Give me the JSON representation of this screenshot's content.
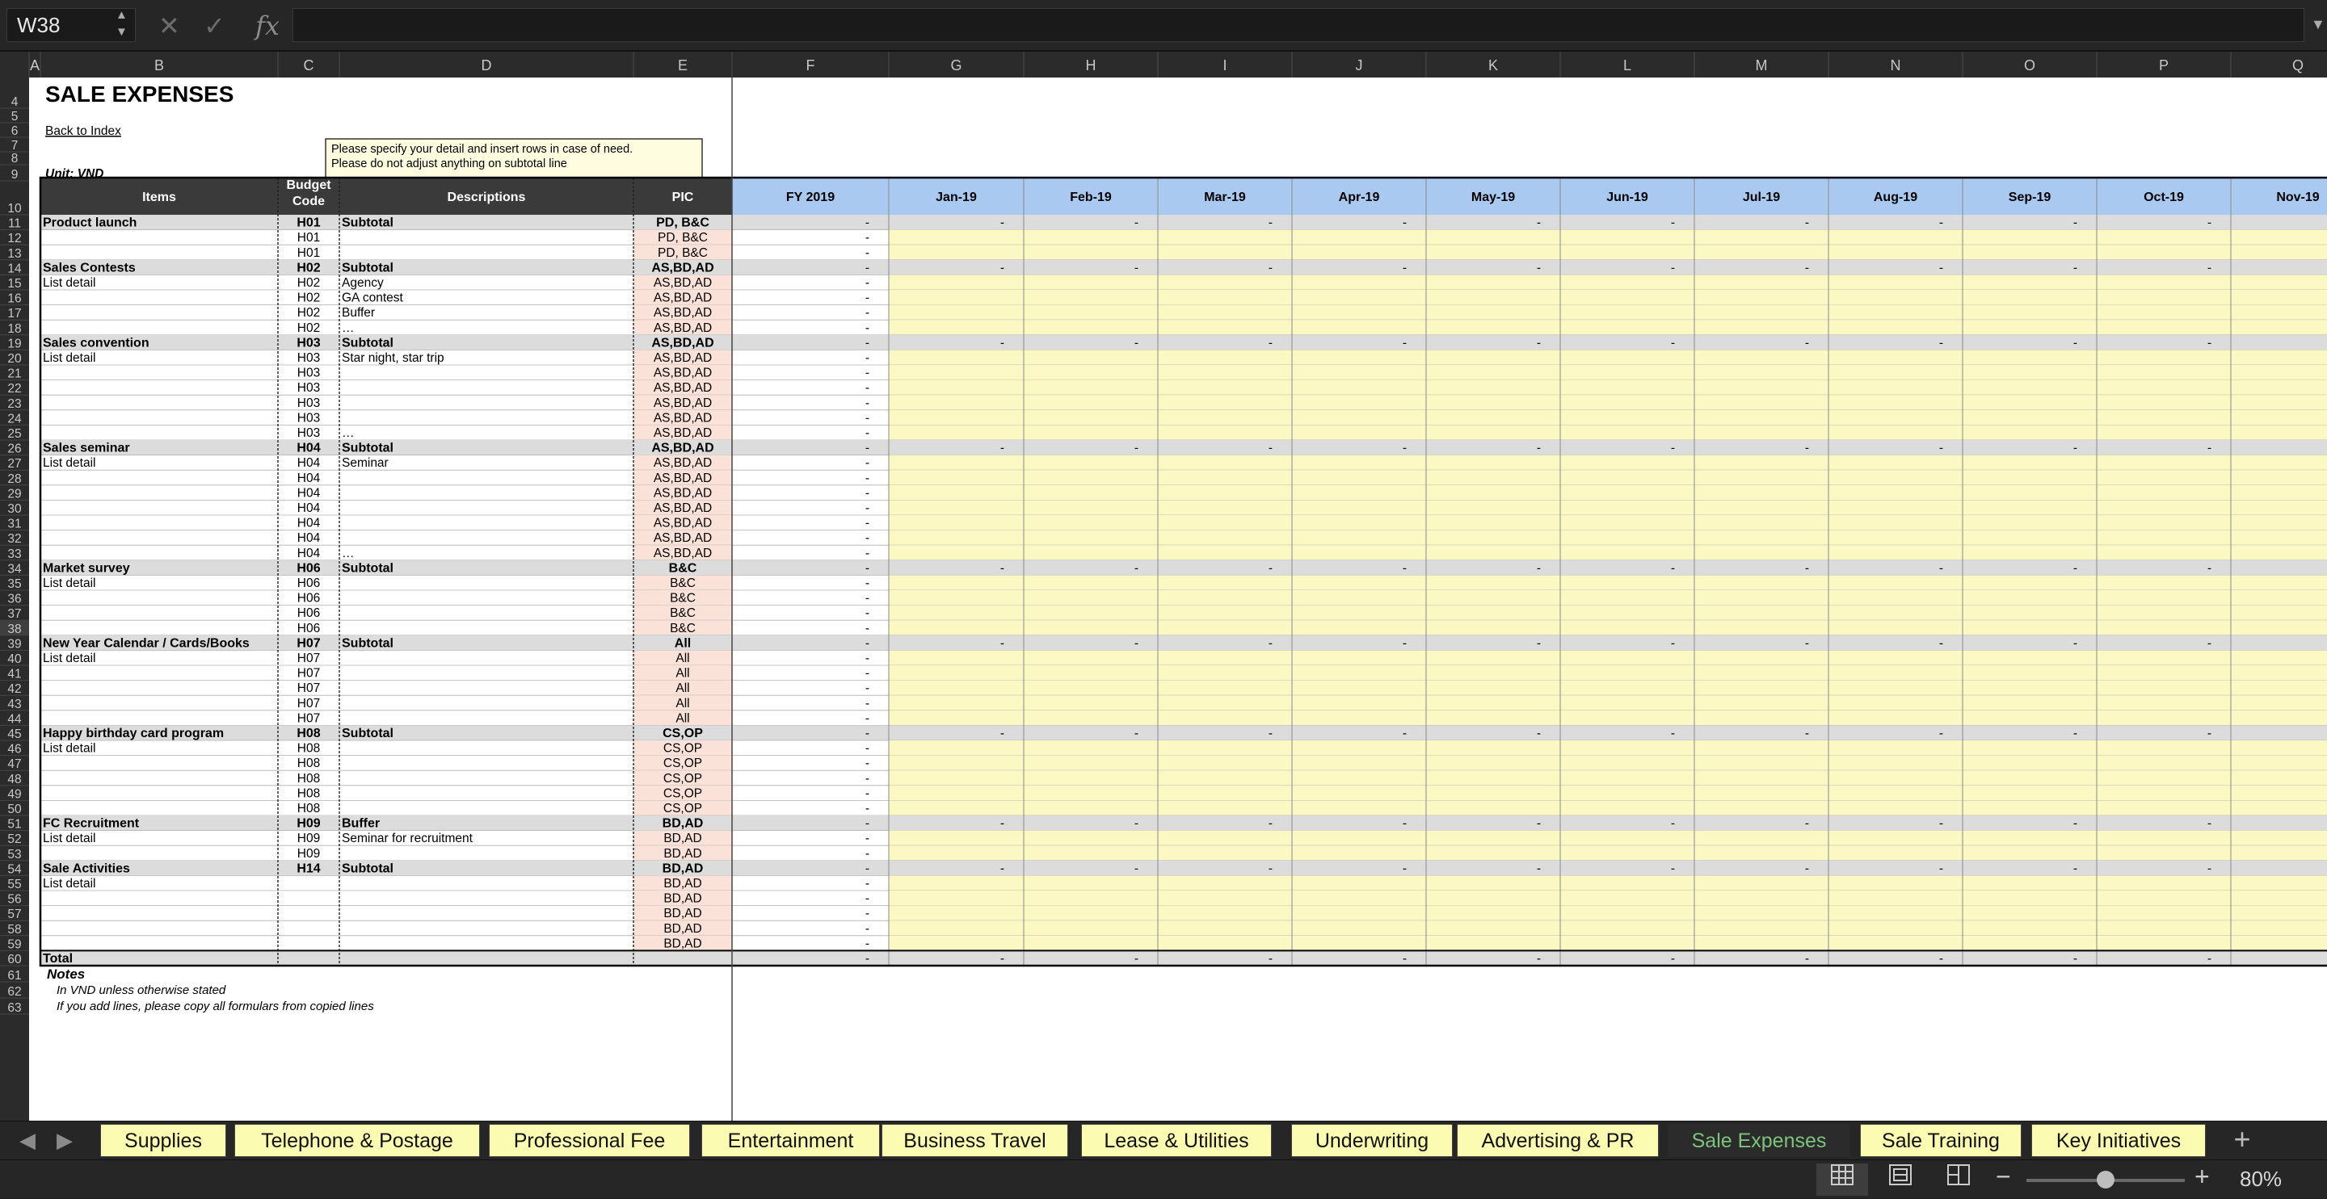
{
  "name_box": "W38",
  "formula": "",
  "icons": {
    "cancel": "cross-icon",
    "confirm": "check-icon",
    "function": "fx-icon"
  },
  "columns": [
    "A",
    "B",
    "C",
    "D",
    "E",
    "F",
    "G",
    "H",
    "I",
    "J",
    "K",
    "L",
    "M",
    "N",
    "O",
    "P",
    "Q"
  ],
  "title": "SALE EXPENSES",
  "back_link": "Back to Index",
  "comment": [
    "Please specify your detail and insert rows in case of need.",
    "Please do not adjust anything on subtotal line"
  ],
  "unit": "Unit: VND",
  "headers": {
    "items": "Items",
    "budget_code": [
      "Budget",
      "Code"
    ],
    "descriptions": "Descriptions",
    "pic": "PIC",
    "fy": "FY 2019",
    "months": [
      "Jan-19",
      "Feb-19",
      "Mar-19",
      "Apr-19",
      "May-19",
      "Jun-19",
      "Jul-19",
      "Aug-19",
      "Sep-19",
      "Oct-19",
      "Nov-19"
    ]
  },
  "dash": "-",
  "rows": [
    {
      "r": 11,
      "t": "sub",
      "item": "Product launch",
      "code": "H01",
      "desc": "Subtotal",
      "pic": "PD, B&C"
    },
    {
      "r": 12,
      "t": "det",
      "item": "",
      "code": "H01",
      "desc": "",
      "pic": "PD, B&C"
    },
    {
      "r": 13,
      "t": "det",
      "item": "",
      "code": "H01",
      "desc": "",
      "pic": "PD, B&C"
    },
    {
      "r": 14,
      "t": "sub",
      "item": "Sales Contests",
      "code": "H02",
      "desc": "Subtotal",
      "pic": "AS,BD,AD"
    },
    {
      "r": 15,
      "t": "det",
      "item": "List detail",
      "code": "H02",
      "desc": "Agency",
      "pic": "AS,BD,AD"
    },
    {
      "r": 16,
      "t": "det",
      "item": "",
      "code": "H02",
      "desc": "GA contest",
      "pic": "AS,BD,AD"
    },
    {
      "r": 17,
      "t": "det",
      "item": "",
      "code": "H02",
      "desc": "Buffer",
      "pic": "AS,BD,AD"
    },
    {
      "r": 18,
      "t": "det",
      "item": "",
      "code": "H02",
      "desc": "…",
      "pic": "AS,BD,AD"
    },
    {
      "r": 19,
      "t": "sub",
      "item": "Sales convention",
      "code": "H03",
      "desc": "Subtotal",
      "pic": "AS,BD,AD"
    },
    {
      "r": 20,
      "t": "det",
      "item": "List detail",
      "code": "H03",
      "desc": "Star night, star trip",
      "pic": "AS,BD,AD"
    },
    {
      "r": 21,
      "t": "det",
      "item": "",
      "code": "H03",
      "desc": "",
      "pic": "AS,BD,AD"
    },
    {
      "r": 22,
      "t": "det",
      "item": "",
      "code": "H03",
      "desc": "",
      "pic": "AS,BD,AD"
    },
    {
      "r": 23,
      "t": "det",
      "item": "",
      "code": "H03",
      "desc": "",
      "pic": "AS,BD,AD"
    },
    {
      "r": 24,
      "t": "det",
      "item": "",
      "code": "H03",
      "desc": "",
      "pic": "AS,BD,AD"
    },
    {
      "r": 25,
      "t": "det",
      "item": "",
      "code": "H03",
      "desc": "…",
      "pic": "AS,BD,AD"
    },
    {
      "r": 26,
      "t": "sub",
      "item": "Sales seminar",
      "code": "H04",
      "desc": "Subtotal",
      "pic": "AS,BD,AD"
    },
    {
      "r": 27,
      "t": "det",
      "item": "List detail",
      "code": "H04",
      "desc": "Seminar",
      "pic": "AS,BD,AD"
    },
    {
      "r": 28,
      "t": "det",
      "item": "",
      "code": "H04",
      "desc": "",
      "pic": "AS,BD,AD"
    },
    {
      "r": 29,
      "t": "det",
      "item": "",
      "code": "H04",
      "desc": "",
      "pic": "AS,BD,AD"
    },
    {
      "r": 30,
      "t": "det",
      "item": "",
      "code": "H04",
      "desc": "",
      "pic": "AS,BD,AD"
    },
    {
      "r": 31,
      "t": "det",
      "item": "",
      "code": "H04",
      "desc": "",
      "pic": "AS,BD,AD"
    },
    {
      "r": 32,
      "t": "det",
      "item": "",
      "code": "H04",
      "desc": "",
      "pic": "AS,BD,AD"
    },
    {
      "r": 33,
      "t": "det",
      "item": "",
      "code": "H04",
      "desc": "…",
      "pic": "AS,BD,AD"
    },
    {
      "r": 34,
      "t": "sub",
      "item": "Market survey",
      "code": "H06",
      "desc": "Subtotal",
      "pic": "B&C"
    },
    {
      "r": 35,
      "t": "det",
      "item": "List detail",
      "code": "H06",
      "desc": "",
      "pic": "B&C"
    },
    {
      "r": 36,
      "t": "det",
      "item": "",
      "code": "H06",
      "desc": "",
      "pic": "B&C"
    },
    {
      "r": 37,
      "t": "det",
      "item": "",
      "code": "H06",
      "desc": "",
      "pic": "B&C"
    },
    {
      "r": 38,
      "t": "det",
      "item": "",
      "code": "H06",
      "desc": "",
      "pic": "B&C"
    },
    {
      "r": 39,
      "t": "sub",
      "item": "New Year Calendar / Cards/Books",
      "code": "H07",
      "desc": "Subtotal",
      "pic": "All"
    },
    {
      "r": 40,
      "t": "det",
      "item": "List detail",
      "code": "H07",
      "desc": "",
      "pic": "All"
    },
    {
      "r": 41,
      "t": "det",
      "item": "",
      "code": "H07",
      "desc": "",
      "pic": "All"
    },
    {
      "r": 42,
      "t": "det",
      "item": "",
      "code": "H07",
      "desc": "",
      "pic": "All"
    },
    {
      "r": 43,
      "t": "det",
      "item": "",
      "code": "H07",
      "desc": "",
      "pic": "All"
    },
    {
      "r": 44,
      "t": "det",
      "item": "",
      "code": "H07",
      "desc": "",
      "pic": "All"
    },
    {
      "r": 45,
      "t": "sub",
      "item": "Happy birthday card program",
      "code": "H08",
      "desc": "Subtotal",
      "pic": "CS,OP"
    },
    {
      "r": 46,
      "t": "det",
      "item": "List detail",
      "code": "H08",
      "desc": "",
      "pic": "CS,OP"
    },
    {
      "r": 47,
      "t": "det",
      "item": "",
      "code": "H08",
      "desc": "",
      "pic": "CS,OP"
    },
    {
      "r": 48,
      "t": "det",
      "item": "",
      "code": "H08",
      "desc": "",
      "pic": "CS,OP"
    },
    {
      "r": 49,
      "t": "det",
      "item": "",
      "code": "H08",
      "desc": "",
      "pic": "CS,OP"
    },
    {
      "r": 50,
      "t": "det",
      "item": "",
      "code": "H08",
      "desc": "",
      "pic": "CS,OP"
    },
    {
      "r": 51,
      "t": "sub",
      "item": "FC Recruitment",
      "code": "H09",
      "desc": "Buffer",
      "pic": "BD,AD"
    },
    {
      "r": 52,
      "t": "det",
      "item": "List detail",
      "code": "H09",
      "desc": "Seminar for recruitment",
      "pic": "BD,AD"
    },
    {
      "r": 53,
      "t": "det",
      "item": "",
      "code": "H09",
      "desc": "",
      "pic": "BD,AD"
    },
    {
      "r": 54,
      "t": "sub",
      "item": "Sale  Activities",
      "code": "H14",
      "desc": "Subtotal",
      "pic": "BD,AD"
    },
    {
      "r": 55,
      "t": "det",
      "item": "List detail",
      "code": "",
      "desc": "",
      "pic": "BD,AD"
    },
    {
      "r": 56,
      "t": "det",
      "item": "",
      "code": "",
      "desc": "",
      "pic": "BD,AD"
    },
    {
      "r": 57,
      "t": "det",
      "item": "",
      "code": "",
      "desc": "",
      "pic": "BD,AD"
    },
    {
      "r": 58,
      "t": "det",
      "item": "",
      "code": "",
      "desc": "",
      "pic": "BD,AD"
    },
    {
      "r": 59,
      "t": "det",
      "item": "",
      "code": "",
      "desc": "",
      "pic": "BD,AD"
    },
    {
      "r": 60,
      "t": "tot",
      "item": "Total",
      "code": "",
      "desc": "",
      "pic": ""
    }
  ],
  "notes": {
    "title": "Notes",
    "lines": [
      "In VND unless otherwise stated",
      "If you add lines, please copy all formulars from copied lines"
    ]
  },
  "tabs": [
    "Supplies",
    "Telephone & Postage",
    "Professional Fee",
    "Entertainment",
    "Business Travel",
    "Lease & Utilities",
    "Underwriting",
    "Advertising & PR",
    "Sale Expenses",
    "Sale Training",
    "Key Initiatives"
  ],
  "active_tab": "Sale Expenses",
  "status": {
    "zoom": "80%",
    "zoom_level": 0.5,
    "views": [
      "normal-view-icon",
      "page-layout-icon",
      "page-break-icon"
    ]
  },
  "colors": {
    "header_dark": "#3a3a3a",
    "month_header": "#a9c9f0",
    "input_yellow": "#fbf8c4",
    "subtotal_gray": "#dcdcdc",
    "pic_pink": "#fbe2d8",
    "total_red": "#c00000",
    "active_tab_text": "#7cc47a"
  }
}
